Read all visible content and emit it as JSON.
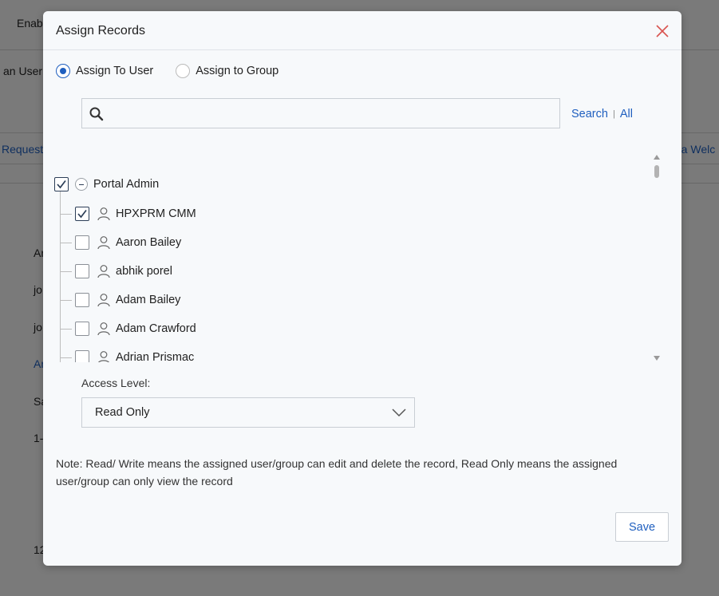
{
  "background": {
    "texts": [
      "Enab",
      "an User",
      "Request",
      "d a Welc",
      "An",
      "jo",
      "jo",
      "An",
      "Sa",
      "1-",
      "12"
    ]
  },
  "modal": {
    "title": "Assign Records",
    "close_icon": "close-icon",
    "radios": {
      "user_label": "Assign To User",
      "group_label": "Assign to Group",
      "selected": "user"
    },
    "search": {
      "placeholder": "",
      "value": "",
      "search_link": "Search",
      "all_link": "All",
      "separator": "|"
    },
    "tree": {
      "root_label": "Portal Admin",
      "root_checked": true,
      "items": [
        {
          "label": "HPXPRM CMM",
          "checked": true
        },
        {
          "label": "Aaron Bailey",
          "checked": false
        },
        {
          "label": "abhik porel",
          "checked": false
        },
        {
          "label": "Adam Bailey",
          "checked": false
        },
        {
          "label": "Adam Crawford",
          "checked": false
        },
        {
          "label": "Adrian Prismac",
          "checked": false
        }
      ]
    },
    "access_level": {
      "label": "Access Level:",
      "value": "Read Only"
    },
    "note": "Note: Read/ Write means the assigned user/group can edit and delete the record, Read Only means the assigned user/group can only view the record",
    "save_label": "Save"
  },
  "colors": {
    "accent": "#1f5fbf",
    "close": "#d9534f"
  }
}
